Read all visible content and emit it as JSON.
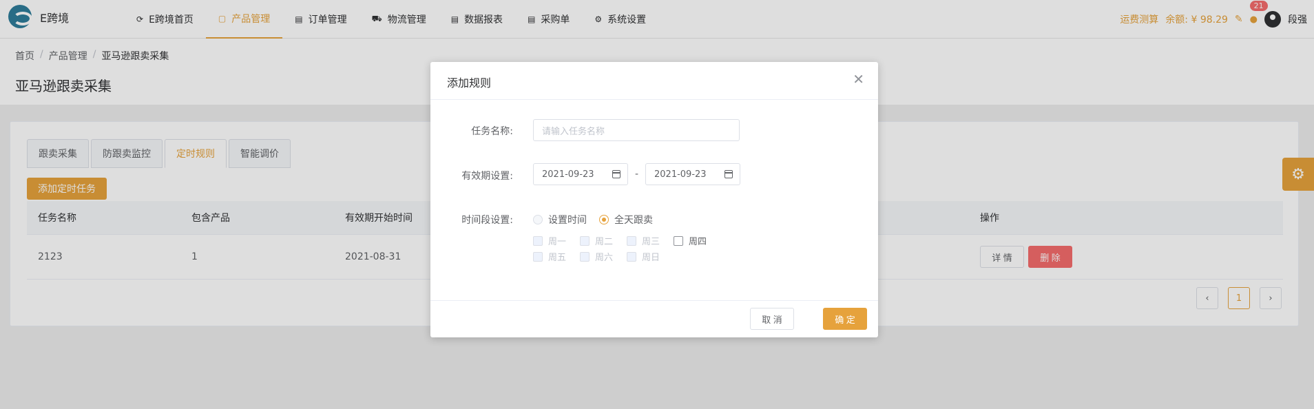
{
  "app": {
    "brand": "E跨境"
  },
  "nav": [
    {
      "label": "E跨境首页",
      "icon": "refresh-icon"
    },
    {
      "label": "产品管理",
      "icon": "box-icon",
      "active": true
    },
    {
      "label": "订单管理",
      "icon": "list-icon"
    },
    {
      "label": "物流管理",
      "icon": "truck-icon"
    },
    {
      "label": "数据报表",
      "icon": "report-icon"
    },
    {
      "label": "采购单",
      "icon": "document-icon"
    },
    {
      "label": "系统设置",
      "icon": "gear-icon"
    }
  ],
  "header_right": {
    "freight_calc": "运费测算",
    "balance": "余额: ¥ 98.29",
    "notifications": "21",
    "username": "段强"
  },
  "breadcrumb": [
    "首页",
    "产品管理",
    "亚马逊跟卖采集"
  ],
  "page_title": "亚马逊跟卖采集",
  "tabs": [
    "跟卖采集",
    "防跟卖监控",
    "定时规则",
    "智能调价"
  ],
  "add_button": "添加定时任务",
  "table": {
    "headers": [
      "任务名称",
      "包含产品",
      "有效期开始时间",
      "操作"
    ],
    "rows": [
      {
        "name": "2123",
        "products": "1",
        "start": "2021-08-31",
        "detail": "详 情",
        "delete": "删 除"
      }
    ]
  },
  "pagination": {
    "current": "1"
  },
  "dialog": {
    "title": "添加规则",
    "task_label": "任务名称:",
    "task_placeholder": "请输入任务名称",
    "validity_label": "有效期设置:",
    "start_date": "2021-09-23",
    "end_date": "2021-09-23",
    "range_sep": "-",
    "period_label": "时间段设置:",
    "radio_set_time": "设置时间",
    "radio_all_day": "全天跟卖",
    "weekdays": [
      "周一",
      "周二",
      "周三",
      "周四",
      "周五",
      "周六",
      "周日"
    ],
    "cancel": "取 消",
    "confirm": "确 定"
  },
  "colors": {
    "accent": "#e6a23c",
    "danger": "#f56c6c"
  }
}
